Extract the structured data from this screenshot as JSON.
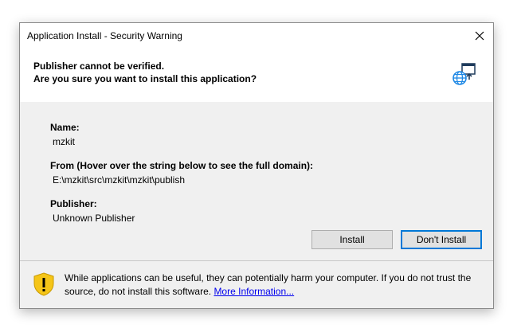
{
  "window": {
    "title": "Application Install - Security Warning"
  },
  "header": {
    "line1": "Publisher cannot be verified.",
    "line2": "Are you sure you want to install this application?",
    "icon": "globe-window-icon"
  },
  "details": {
    "name_label": "Name:",
    "name_value": "mzkit",
    "from_label": "From (Hover over the string below to see the full domain):",
    "from_value": "E:\\mzkit\\src\\mzkit\\mzkit\\publish",
    "publisher_label": "Publisher:",
    "publisher_value": "Unknown Publisher"
  },
  "buttons": {
    "install": "Install",
    "dont_install": "Don't Install"
  },
  "footer": {
    "warning_text": "While applications can be useful, they can potentially harm your computer. If you do not trust the source, do not install this software. ",
    "more_info_link": "More Information...",
    "icon": "shield-warning-icon"
  },
  "colors": {
    "accent": "#0078d7",
    "shield": "#f5c518",
    "link": "#0000ee"
  }
}
